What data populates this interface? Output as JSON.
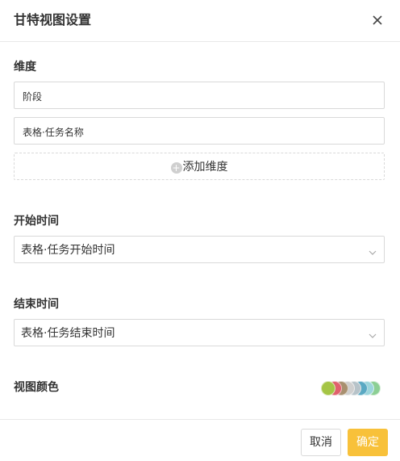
{
  "header": {
    "title": "甘特视图设置"
  },
  "dimension": {
    "label": "维度",
    "items": [
      "阶段",
      "表格·任务名称"
    ],
    "add_label": "添加维度"
  },
  "start_time": {
    "label": "开始时间",
    "value": "表格·任务开始时间"
  },
  "end_time": {
    "label": "结束时间",
    "value": "表格·任务结束时间"
  },
  "view_color": {
    "label": "视图颜色",
    "colors": [
      "#a5c545",
      "#e0606c",
      "#a8906f",
      "#cfcfcf",
      "#b7c3c9",
      "#5aa9c3",
      "#9bd5db",
      "#8ccf94"
    ]
  },
  "footer": {
    "cancel_label": "取消",
    "ok_label": "确定"
  },
  "colors": {
    "accent": "#f8c13a",
    "border": "#d9d9d9"
  }
}
